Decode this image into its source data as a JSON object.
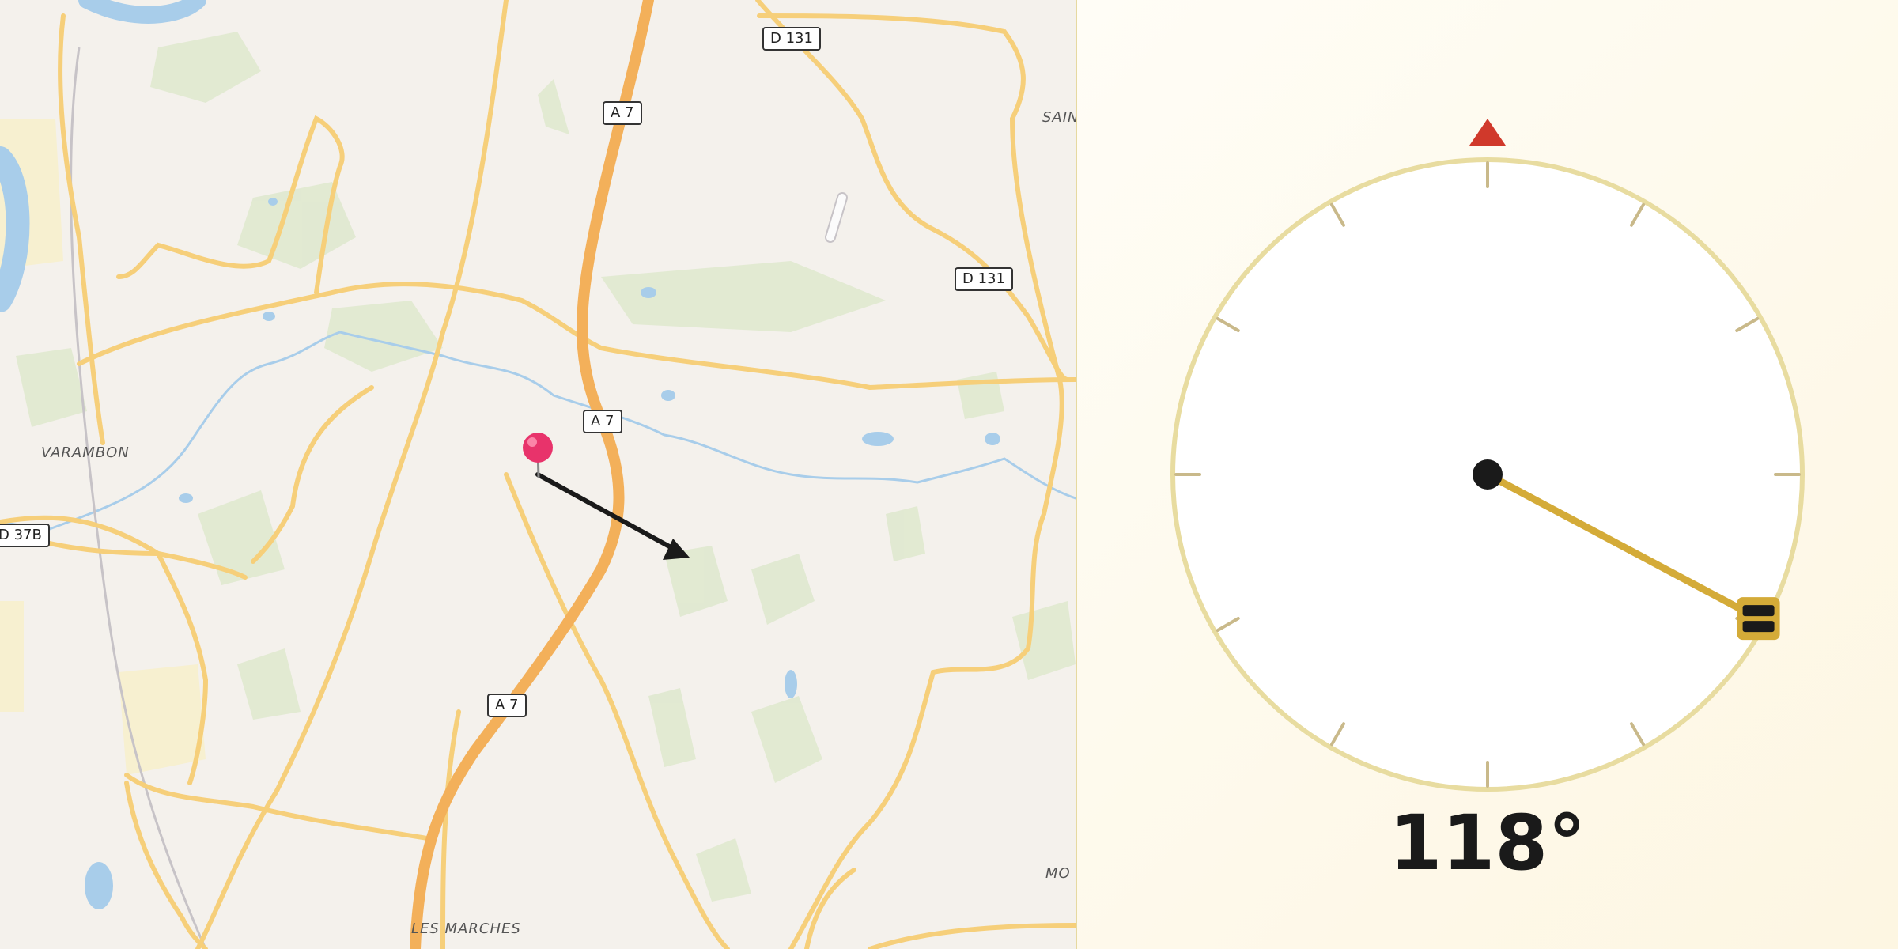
{
  "map": {
    "road_shields": [
      {
        "id": "shield-d131-top",
        "label": "D 131"
      },
      {
        "id": "shield-a7-top",
        "label": "A 7"
      },
      {
        "id": "shield-d131-right",
        "label": "D 131"
      },
      {
        "id": "shield-a7-mid",
        "label": "A 7"
      },
      {
        "id": "shield-d37b",
        "label": "D 37B"
      },
      {
        "id": "shield-a7-bottom",
        "label": "A 7"
      }
    ],
    "places": [
      {
        "id": "place-varambon",
        "label": "VARAMBON"
      },
      {
        "id": "place-les-marches",
        "label": "LES MARCHES"
      },
      {
        "id": "place-sain",
        "label": "SAIN"
      },
      {
        "id": "place-mo",
        "label": "MO"
      }
    ],
    "marker": {
      "icon": "map-pin-icon",
      "color": "#e8336b"
    },
    "direction_arrow": {
      "icon": "arrow-icon",
      "color": "#1a1a1a"
    },
    "colors": {
      "road": "#f6cf7a",
      "motorway": "#f3b05a",
      "river": "#a8cdea",
      "forest": "#dde8cc",
      "background": "#f4f1ec"
    }
  },
  "compass": {
    "heading_deg": 118,
    "heading_label": "118°",
    "north_marker_icon": "north-triangle-icon",
    "needle_handle_icon": "needle-handle-icon",
    "colors": {
      "ring": "#e8dca0",
      "needle": "#d4ab38",
      "north": "#d0392b",
      "ticks": "#c9b98a",
      "hub": "#1a1a1a"
    }
  }
}
